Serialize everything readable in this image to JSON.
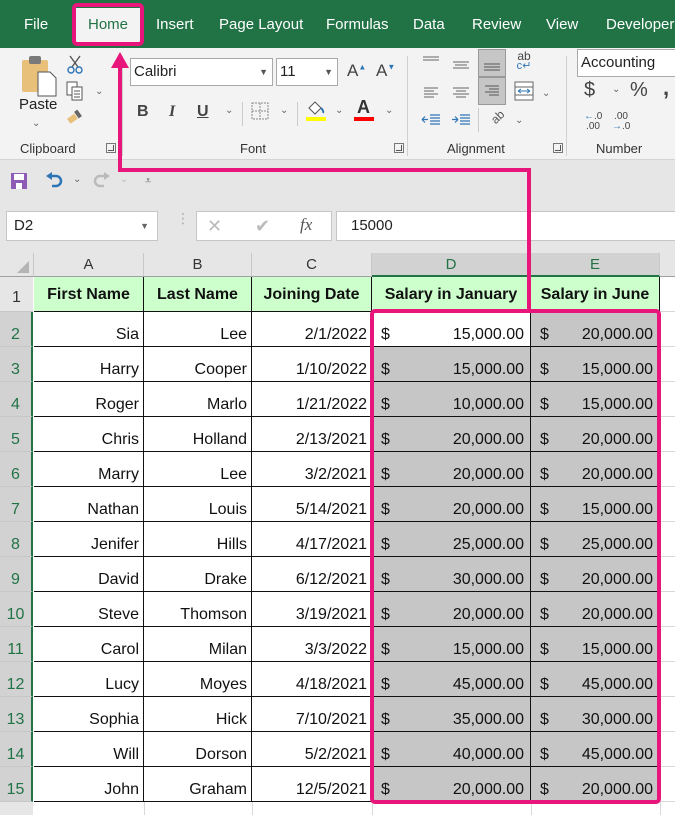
{
  "tabs": [
    {
      "label": "File"
    },
    {
      "label": "Home",
      "active": true
    },
    {
      "label": "Insert"
    },
    {
      "label": "Page Layout"
    },
    {
      "label": "Formulas"
    },
    {
      "label": "Data"
    },
    {
      "label": "Review"
    },
    {
      "label": "View"
    },
    {
      "label": "Developer"
    }
  ],
  "ribbon": {
    "clipboard": {
      "label": "Clipboard",
      "paste_label": "Paste",
      "icons": [
        "paste-icon",
        "cut-icon",
        "copy-icon",
        "format-painter-icon"
      ]
    },
    "font": {
      "label": "Font",
      "font_name": "Calibri",
      "font_size": "11",
      "increase_font_glyph": "A",
      "decrease_font_glyph": "A",
      "bold_glyph": "B",
      "italic_glyph": "I",
      "underline_glyph": "U",
      "font_color_glyph": "A",
      "fill_color": "#ffff00",
      "font_color": "#ff0000"
    },
    "alignment": {
      "label": "Alignment",
      "wrap_glyph": "ab",
      "orientation_glyph": "ab"
    },
    "number": {
      "label": "Number",
      "format": "Accounting",
      "currency_glyph": "$",
      "percent_glyph": "%",
      "comma_glyph": ",",
      "increase_decimal": "←.0 .00",
      "decrease_decimal": ".00 →.0"
    }
  },
  "formula_bar": {
    "name_box": "D2",
    "fx_glyph": "fx",
    "value": "15000"
  },
  "sheet": {
    "columns": [
      "A",
      "B",
      "C",
      "D",
      "E"
    ],
    "selected_columns": [
      "D",
      "E"
    ],
    "headers": [
      "First Name",
      "Last Name",
      "Joining Date",
      "Salary in January",
      "Salary in June"
    ],
    "currency_symbol": "$",
    "rows": [
      {
        "row": "2",
        "first": "Sia",
        "last": "Lee",
        "date": "2/1/2022",
        "jan": "15,000.00",
        "jun": "20,000.00"
      },
      {
        "row": "3",
        "first": "Harry",
        "last": "Cooper",
        "date": "1/10/2022",
        "jan": "15,000.00",
        "jun": "15,000.00"
      },
      {
        "row": "4",
        "first": "Roger",
        "last": "Marlo",
        "date": "1/21/2022",
        "jan": "10,000.00",
        "jun": "15,000.00"
      },
      {
        "row": "5",
        "first": "Chris",
        "last": "Holland",
        "date": "2/13/2021",
        "jan": "20,000.00",
        "jun": "20,000.00"
      },
      {
        "row": "6",
        "first": "Marry",
        "last": "Lee",
        "date": "3/2/2021",
        "jan": "20,000.00",
        "jun": "20,000.00"
      },
      {
        "row": "7",
        "first": "Nathan",
        "last": "Louis",
        "date": "5/14/2021",
        "jan": "20,000.00",
        "jun": "15,000.00"
      },
      {
        "row": "8",
        "first": "Jenifer",
        "last": "Hills",
        "date": "4/17/2021",
        "jan": "25,000.00",
        "jun": "25,000.00"
      },
      {
        "row": "9",
        "first": "David",
        "last": "Drake",
        "date": "6/12/2021",
        "jan": "30,000.00",
        "jun": "20,000.00"
      },
      {
        "row": "10",
        "first": "Steve",
        "last": "Thomson",
        "date": "3/19/2021",
        "jan": "20,000.00",
        "jun": "20,000.00"
      },
      {
        "row": "11",
        "first": "Carol",
        "last": "Milan",
        "date": "3/3/2022",
        "jan": "15,000.00",
        "jun": "15,000.00"
      },
      {
        "row": "12",
        "first": "Lucy",
        "last": "Moyes",
        "date": "4/18/2021",
        "jan": "45,000.00",
        "jun": "45,000.00"
      },
      {
        "row": "13",
        "first": "Sophia",
        "last": "Hick",
        "date": "7/10/2021",
        "jan": "35,000.00",
        "jun": "30,000.00"
      },
      {
        "row": "14",
        "first": "Will",
        "last": "Dorson",
        "date": "5/2/2021",
        "jan": "40,000.00",
        "jun": "45,000.00"
      },
      {
        "row": "15",
        "first": "John",
        "last": "Graham",
        "date": "12/5/2021",
        "jan": "20,000.00",
        "jun": "20,000.00"
      }
    ]
  },
  "colors": {
    "ribbon_green": "#217346",
    "header_fill": "#ccffcc",
    "selection_fill": "#c6c6c6",
    "annotation": "#e8157a"
  }
}
